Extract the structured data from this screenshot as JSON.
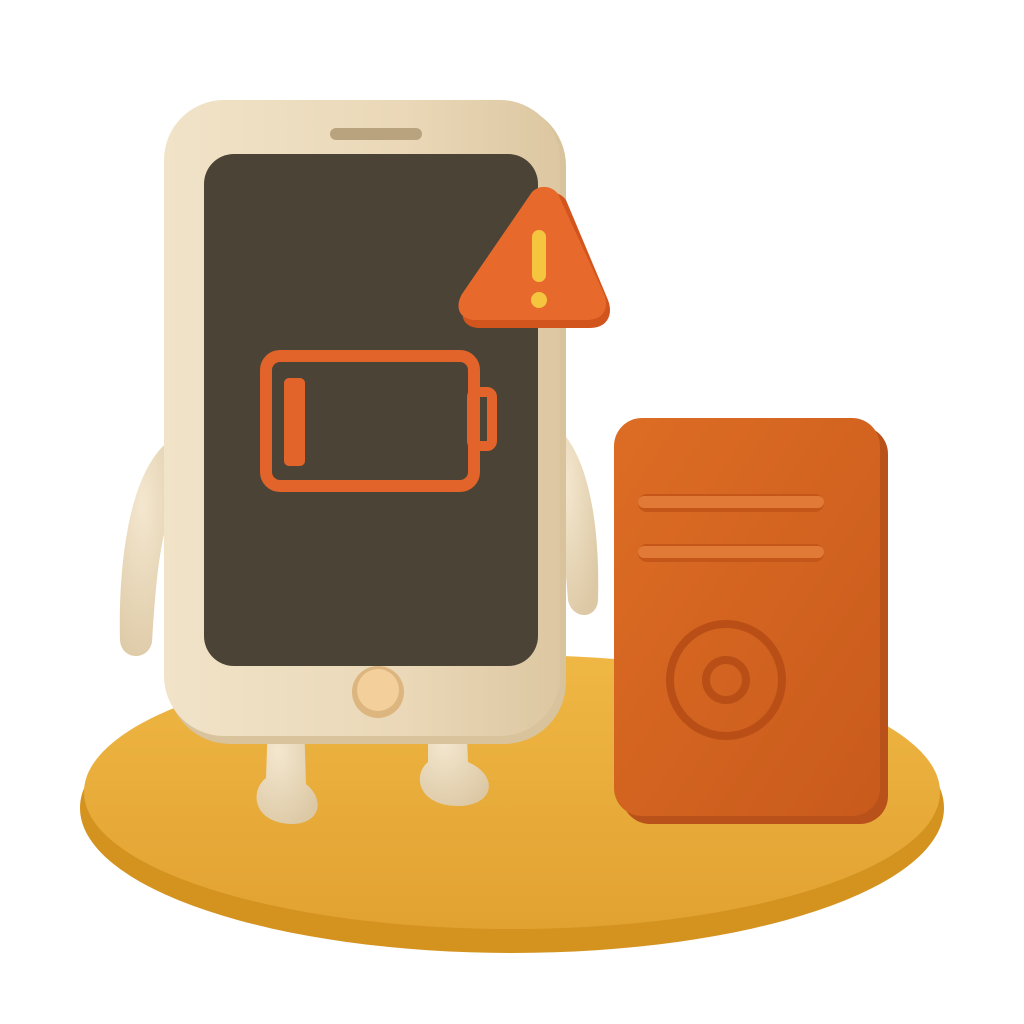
{
  "scene": {
    "subject": "phone",
    "icons": {
      "battery": "battery-low-icon",
      "warning": "warning-triangle-icon",
      "speaker": "power-bank-icon"
    },
    "battery_level": 0.12,
    "colors": {
      "background": "#ffffff",
      "platform": "#e9ad3a",
      "platform_shadow": "#d49526",
      "phone_body": "#ecdcbf",
      "phone_edge": "#d9c6a2",
      "screen": "#4b4436",
      "battery_outline": "#e2642a",
      "warning_fill": "#e8692c",
      "warning_mark": "#f6c53f",
      "power_bank": "#d8661f",
      "power_bank_side": "#b9521a",
      "home_button": "#f3cf9b"
    }
  }
}
